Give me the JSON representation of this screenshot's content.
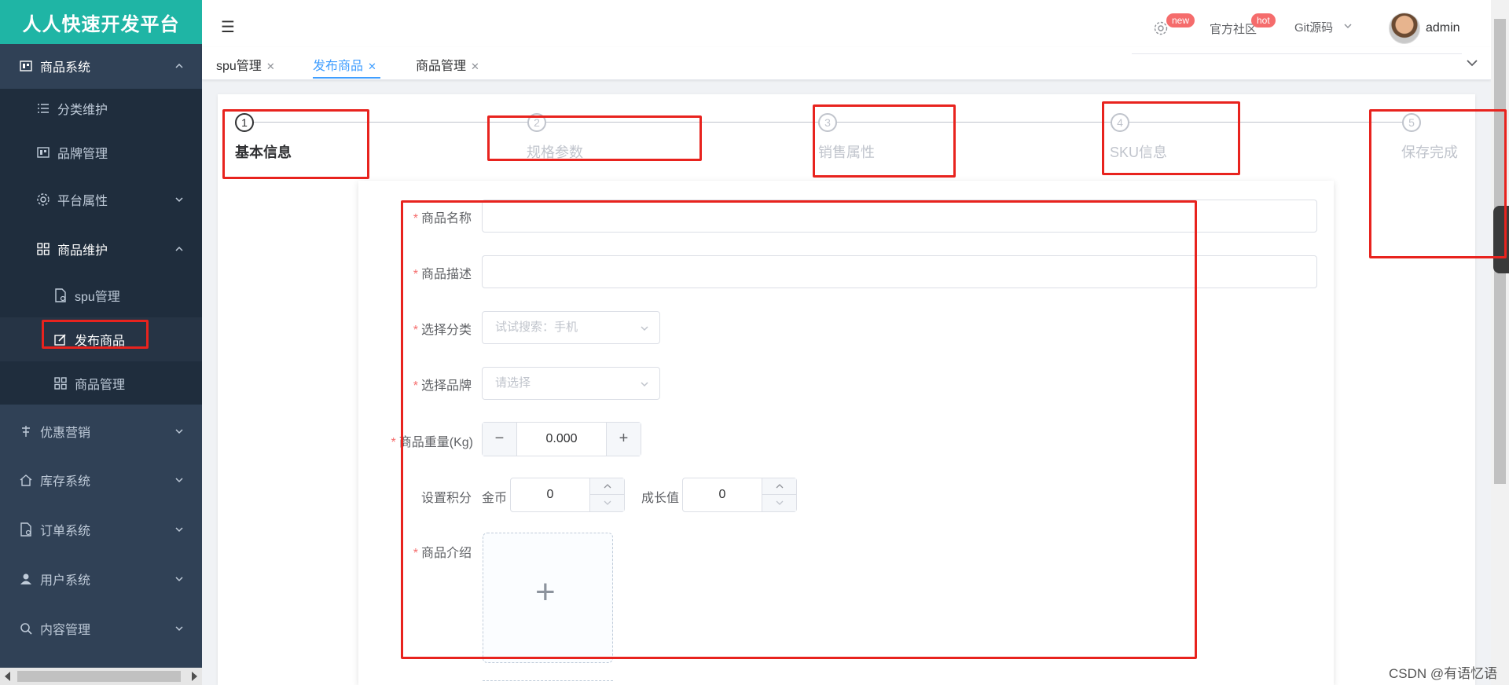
{
  "sidebar": {
    "logo": "人人快速开发平台",
    "items": [
      {
        "label": "商品系统"
      },
      {
        "label": "分类维护"
      },
      {
        "label": "品牌管理"
      },
      {
        "label": "平台属性"
      },
      {
        "label": "商品维护"
      },
      {
        "label": "spu管理"
      },
      {
        "label": "发布商品"
      },
      {
        "label": "商品管理"
      },
      {
        "label": "优惠营销"
      },
      {
        "label": "库存系统"
      },
      {
        "label": "订单系统"
      },
      {
        "label": "用户系统"
      },
      {
        "label": "内容管理"
      }
    ]
  },
  "header": {
    "menu_icon": "☰",
    "settings_badge": "new",
    "community": "官方社区",
    "community_badge": "hot",
    "git": "Git源码",
    "user": "admin"
  },
  "tabs": [
    {
      "label": "spu管理"
    },
    {
      "label": "发布商品"
    },
    {
      "label": "商品管理"
    }
  ],
  "steps": [
    {
      "num": "1",
      "title": "基本信息"
    },
    {
      "num": "2",
      "title": "规格参数"
    },
    {
      "num": "3",
      "title": "销售属性"
    },
    {
      "num": "4",
      "title": "SKU信息"
    },
    {
      "num": "5",
      "title": "保存完成"
    }
  ],
  "form": {
    "name_label": "商品名称",
    "desc_label": "商品描述",
    "category_label": "选择分类",
    "category_placeholder": "试试搜索：手机",
    "brand_label": "选择品牌",
    "brand_placeholder": "请选择",
    "weight_label": "商品重量(Kg)",
    "weight_value": "0.000",
    "points_label": "设置积分",
    "coin_label": "金币",
    "coin_value": "0",
    "growth_label": "成长值",
    "growth_value": "0",
    "intro_label": "商品介绍",
    "minus": "−",
    "plus": "+",
    "upload_plus": "+"
  },
  "watermark": "CSDN @有语忆语"
}
